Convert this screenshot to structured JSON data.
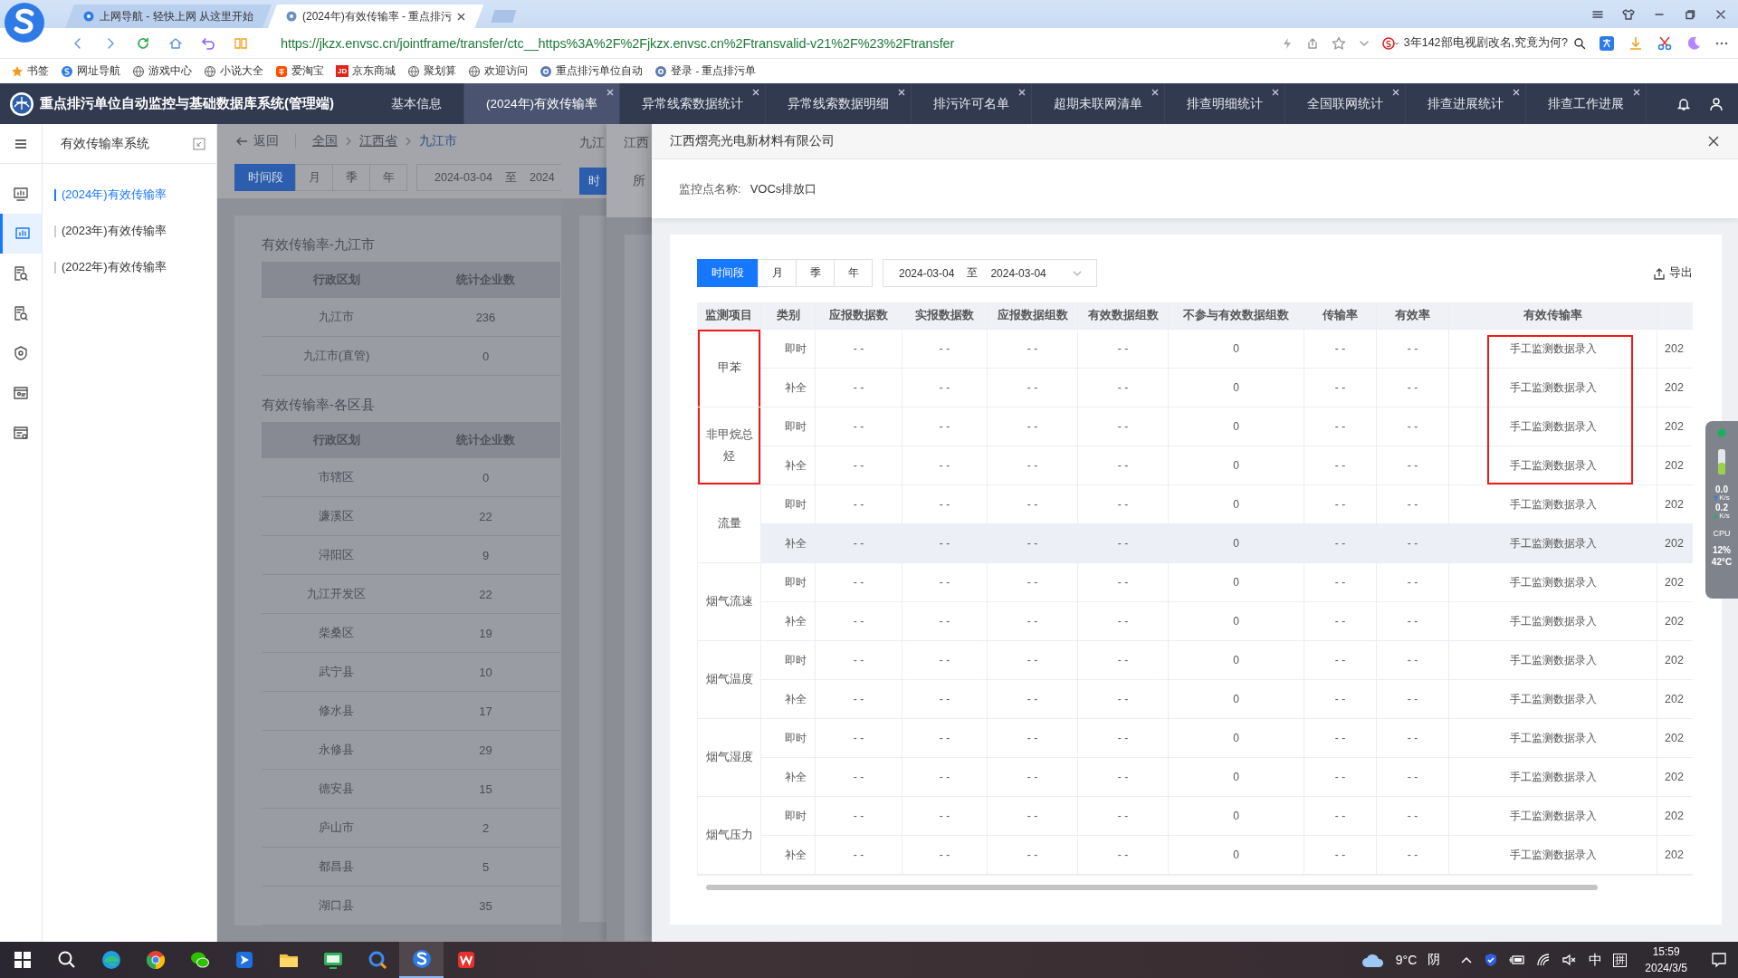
{
  "browser": {
    "tabs": [
      {
        "title": "上网导航 - 轻快上网 从这里开始",
        "selected": false
      },
      {
        "title": "(2024年)有效传输率 - 重点排污",
        "selected": true
      }
    ],
    "url": "https://jkzx.envsc.cn/jointframe/transfer/ctc__https%3A%2F%2Fjkzx.envsc.cn%2Ftransvalid-v21%2F%23%2Ftransfer",
    "search_text": "3年142部电视剧改名,究竟为何?",
    "bookmarks": [
      {
        "label": "书签",
        "kind": "star"
      },
      {
        "label": "网址导航",
        "kind": "sogou"
      },
      {
        "label": "游戏中心",
        "kind": "globe"
      },
      {
        "label": "小说大全",
        "kind": "globe"
      },
      {
        "label": "爱淘宝",
        "kind": "taobao"
      },
      {
        "label": "京东商城",
        "kind": "jd",
        "icon_text": "JD"
      },
      {
        "label": "聚划算",
        "kind": "globe"
      },
      {
        "label": "欢迎访问",
        "kind": "globe"
      },
      {
        "label": "重点排污单位自动",
        "kind": "site"
      },
      {
        "label": "登录 - 重点排污单",
        "kind": "site"
      }
    ]
  },
  "app": {
    "title": "重点排污单位自动监控与基础数据库系统(管理端)",
    "tabs": [
      {
        "label": "基本信息",
        "closable": false,
        "selected": false
      },
      {
        "label": "(2024年)有效传输率",
        "closable": true,
        "selected": true
      },
      {
        "label": "异常线索数据统计",
        "closable": true,
        "selected": false
      },
      {
        "label": "异常线索数据明细",
        "closable": true,
        "selected": false
      },
      {
        "label": "排污许可名单",
        "closable": true,
        "selected": false
      },
      {
        "label": "超期未联网清单",
        "closable": true,
        "selected": false
      },
      {
        "label": "排查明细统计",
        "closable": true,
        "selected": false
      },
      {
        "label": "全国联网统计",
        "closable": true,
        "selected": false
      },
      {
        "label": "排查进展统计",
        "closable": true,
        "selected": false
      },
      {
        "label": "排查工作进展",
        "closable": true,
        "selected": false
      }
    ]
  },
  "nav_rail": [
    {
      "kind": "screen-chart",
      "selected": false
    },
    {
      "kind": "bar-chart",
      "selected": true
    },
    {
      "kind": "doc-search",
      "selected": false
    },
    {
      "kind": "doc-search",
      "selected": false
    },
    {
      "kind": "shield",
      "selected": false
    },
    {
      "kind": "board",
      "selected": false
    },
    {
      "kind": "board-gear",
      "selected": false
    }
  ],
  "sidebar": {
    "title": "有效传输率系统",
    "items": [
      {
        "label": "(2024年)有效传输率",
        "selected": true
      },
      {
        "label": "(2023年)有效传输率",
        "selected": false
      },
      {
        "label": "(2022年)有效传输率",
        "selected": false
      }
    ]
  },
  "main": {
    "back": "返回",
    "breadcrumbs": [
      {
        "label": "全国",
        "current": false
      },
      {
        "label": "江西省",
        "current": false
      },
      {
        "label": "九江市",
        "current": true
      }
    ],
    "periods": [
      {
        "label": "时间段",
        "selected": true
      },
      {
        "label": "月",
        "selected": false
      },
      {
        "label": "季",
        "selected": false
      },
      {
        "label": "年",
        "selected": false
      }
    ],
    "date_from": "2024-03-04",
    "date_sep": "至",
    "date_to": "2024",
    "tables": [
      {
        "title": "有效传输率-九江市",
        "columns": [
          "行政区划",
          "统计企业数"
        ],
        "rows": [
          [
            "九江市",
            "236"
          ],
          [
            "九江市(直管)",
            "0"
          ]
        ]
      },
      {
        "title": "有效传输率-各区县",
        "columns": [
          "行政区划",
          "统计企业数"
        ],
        "rows": [
          [
            "市辖区",
            "0"
          ],
          [
            "濂溪区",
            "22"
          ],
          [
            "浔阳区",
            "9"
          ],
          [
            "九江开发区",
            "22"
          ],
          [
            "柴桑区",
            "19"
          ],
          [
            "武宁县",
            "10"
          ],
          [
            "修水县",
            "17"
          ],
          [
            "永修县",
            "29"
          ],
          [
            "德安县",
            "15"
          ],
          [
            "庐山市",
            "2"
          ],
          [
            "都昌县",
            "5"
          ],
          [
            "湖口县",
            "35"
          ]
        ]
      }
    ]
  },
  "stacked_panels": [
    {
      "title": "九江",
      "button": "时"
    },
    {
      "title": "江西",
      "label": "所"
    }
  ],
  "drawer": {
    "title": "江西熠亮光电新材料有限公司",
    "point_label": "监控点名称:",
    "point_value": "VOCs排放口",
    "periods": [
      {
        "label": "时间段",
        "selected": true
      },
      {
        "label": "月",
        "selected": false
      },
      {
        "label": "季",
        "selected": false
      },
      {
        "label": "年",
        "selected": false
      }
    ],
    "date_from": "2024-03-04",
    "date_sep": "至",
    "date_to": "2024-03-04",
    "export": "导出",
    "table": {
      "columns": [
        "监测项目",
        "类别",
        "应报数据数",
        "实报数据数",
        "应报数据组数",
        "有效数据组数",
        "不参与有效数据组数",
        "传输率",
        "有效率",
        "有效传输率"
      ],
      "groups": [
        {
          "item": "甲苯",
          "highlighted": true,
          "rows": [
            {
              "type": "即时",
              "values": [
                "- -",
                "- -",
                "- -",
                "- -",
                "0",
                "- -",
                "- -"
              ],
              "rate": "手工监测数据录入",
              "rate_highlighted": true,
              "column_11": "202",
              "hovered": false
            },
            {
              "type": "补全",
              "values": [
                "- -",
                "- -",
                "- -",
                "- -",
                "0",
                "- -",
                "- -"
              ],
              "rate": "手工监测数据录入",
              "rate_highlighted": true,
              "column_11": "202",
              "hovered": false
            }
          ]
        },
        {
          "item": "非甲烷总烃",
          "highlighted": true,
          "rows": [
            {
              "type": "即时",
              "values": [
                "- -",
                "- -",
                "- -",
                "- -",
                "0",
                "- -",
                "- -"
              ],
              "rate": "手工监测数据录入",
              "rate_highlighted": true,
              "column_11": "202",
              "hovered": false
            },
            {
              "type": "补全",
              "values": [
                "- -",
                "- -",
                "- -",
                "- -",
                "0",
                "- -",
                "- -"
              ],
              "rate": "手工监测数据录入",
              "rate_highlighted": true,
              "column_11": "202",
              "hovered": false
            }
          ]
        },
        {
          "item": "流量",
          "highlighted": false,
          "rows": [
            {
              "type": "即时",
              "values": [
                "- -",
                "- -",
                "- -",
                "- -",
                "0",
                "- -",
                "- -"
              ],
              "rate": "手工监测数据录入",
              "rate_highlighted": false,
              "column_11": "202",
              "hovered": false
            },
            {
              "type": "补全",
              "values": [
                "- -",
                "- -",
                "- -",
                "- -",
                "0",
                "- -",
                "- -"
              ],
              "rate": "手工监测数据录入",
              "rate_highlighted": false,
              "column_11": "202",
              "hovered": true
            }
          ]
        },
        {
          "item": "烟气流速",
          "highlighted": false,
          "rows": [
            {
              "type": "即时",
              "values": [
                "- -",
                "- -",
                "- -",
                "- -",
                "0",
                "- -",
                "- -"
              ],
              "rate": "手工监测数据录入",
              "rate_highlighted": false,
              "column_11": "202",
              "hovered": false
            },
            {
              "type": "补全",
              "values": [
                "- -",
                "- -",
                "- -",
                "- -",
                "0",
                "- -",
                "- -"
              ],
              "rate": "手工监测数据录入",
              "rate_highlighted": false,
              "column_11": "202",
              "hovered": false
            }
          ]
        },
        {
          "item": "烟气温度",
          "highlighted": false,
          "rows": [
            {
              "type": "即时",
              "values": [
                "- -",
                "- -",
                "- -",
                "- -",
                "0",
                "- -",
                "- -"
              ],
              "rate": "手工监测数据录入",
              "rate_highlighted": false,
              "column_11": "202",
              "hovered": false
            },
            {
              "type": "补全",
              "values": [
                "- -",
                "- -",
                "- -",
                "- -",
                "0",
                "- -",
                "- -"
              ],
              "rate": "手工监测数据录入",
              "rate_highlighted": false,
              "column_11": "202",
              "hovered": false
            }
          ]
        },
        {
          "item": "烟气湿度",
          "highlighted": false,
          "rows": [
            {
              "type": "即时",
              "values": [
                "- -",
                "- -",
                "- -",
                "- -",
                "0",
                "- -",
                "- -"
              ],
              "rate": "手工监测数据录入",
              "rate_highlighted": false,
              "column_11": "202",
              "hovered": false
            },
            {
              "type": "补全",
              "values": [
                "- -",
                "- -",
                "- -",
                "- -",
                "0",
                "- -",
                "- -"
              ],
              "rate": "手工监测数据录入",
              "rate_highlighted": false,
              "column_11": "202",
              "hovered": false
            }
          ]
        },
        {
          "item": "烟气压力",
          "highlighted": false,
          "rows": [
            {
              "type": "即时",
              "values": [
                "- -",
                "- -",
                "- -",
                "- -",
                "0",
                "- -",
                "- -"
              ],
              "rate": "手工监测数据录入",
              "rate_highlighted": false,
              "column_11": "202",
              "hovered": false
            },
            {
              "type": "补全",
              "values": [
                "- -",
                "- -",
                "- -",
                "- -",
                "0",
                "- -",
                "- -"
              ],
              "rate": "手工监测数据录入",
              "rate_highlighted": false,
              "column_11": "202",
              "hovered": false
            }
          ]
        }
      ]
    }
  },
  "monitor_widget": {
    "upload": "0.0",
    "upload_unit": "K/s",
    "download": "0.2",
    "download_unit": "K/s",
    "cpu_label": "CPU",
    "cpu": "12%",
    "temperature": "42°C"
  },
  "taskbar": {
    "apps": [
      {
        "kind": "start",
        "selected": false
      },
      {
        "kind": "search",
        "selected": false
      },
      {
        "kind": "edge",
        "selected": false
      },
      {
        "kind": "chrome",
        "selected": false
      },
      {
        "kind": "wechat",
        "selected": false
      },
      {
        "kind": "arrow-app",
        "selected": false
      },
      {
        "kind": "files",
        "selected": false
      },
      {
        "kind": "green-app",
        "selected": false
      },
      {
        "kind": "search-app",
        "selected": false
      },
      {
        "kind": "sogou",
        "selected": true
      },
      {
        "kind": "wps",
        "selected": false
      }
    ],
    "temperature": "9°C",
    "weather": "阴",
    "ime_language": "中",
    "ime_mode": "拼",
    "time": "15:59",
    "date": "2024/3/5"
  }
}
